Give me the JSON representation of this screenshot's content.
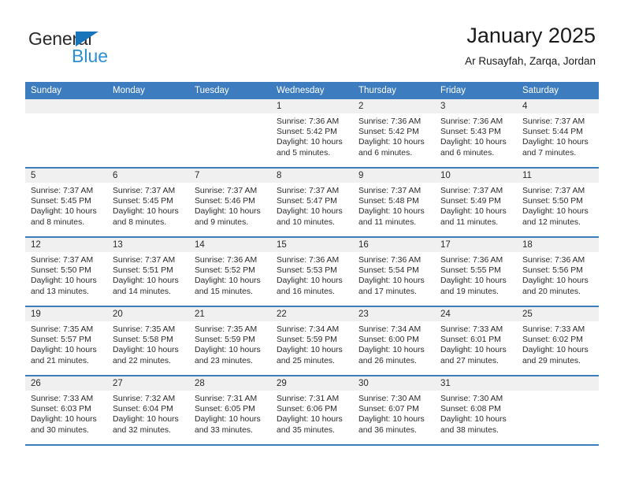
{
  "logo": {
    "primary_text": "General",
    "secondary_text": "Blue",
    "triangle_color": "#1874bb",
    "secondary_color": "#2a8fd4"
  },
  "header": {
    "title": "January 2025",
    "location": "Ar Rusayfah, Zarqa, Jordan"
  },
  "theme": {
    "header_bg": "#3d7cbf",
    "daynum_bg": "#f0f0f0",
    "divider": "#3d7cbf"
  },
  "day_headers": [
    "Sunday",
    "Monday",
    "Tuesday",
    "Wednesday",
    "Thursday",
    "Friday",
    "Saturday"
  ],
  "weeks": [
    [
      {
        "day": "",
        "sunrise": "",
        "sunset": "",
        "daylight_line1": "",
        "daylight_line2": "",
        "empty": true
      },
      {
        "day": "",
        "sunrise": "",
        "sunset": "",
        "daylight_line1": "",
        "daylight_line2": "",
        "empty": true
      },
      {
        "day": "",
        "sunrise": "",
        "sunset": "",
        "daylight_line1": "",
        "daylight_line2": "",
        "empty": true
      },
      {
        "day": "1",
        "sunrise": "Sunrise: 7:36 AM",
        "sunset": "Sunset: 5:42 PM",
        "daylight_line1": "Daylight: 10 hours",
        "daylight_line2": "and 5 minutes.",
        "empty": false
      },
      {
        "day": "2",
        "sunrise": "Sunrise: 7:36 AM",
        "sunset": "Sunset: 5:42 PM",
        "daylight_line1": "Daylight: 10 hours",
        "daylight_line2": "and 6 minutes.",
        "empty": false
      },
      {
        "day": "3",
        "sunrise": "Sunrise: 7:36 AM",
        "sunset": "Sunset: 5:43 PM",
        "daylight_line1": "Daylight: 10 hours",
        "daylight_line2": "and 6 minutes.",
        "empty": false
      },
      {
        "day": "4",
        "sunrise": "Sunrise: 7:37 AM",
        "sunset": "Sunset: 5:44 PM",
        "daylight_line1": "Daylight: 10 hours",
        "daylight_line2": "and 7 minutes.",
        "empty": false
      }
    ],
    [
      {
        "day": "5",
        "sunrise": "Sunrise: 7:37 AM",
        "sunset": "Sunset: 5:45 PM",
        "daylight_line1": "Daylight: 10 hours",
        "daylight_line2": "and 8 minutes.",
        "empty": false
      },
      {
        "day": "6",
        "sunrise": "Sunrise: 7:37 AM",
        "sunset": "Sunset: 5:45 PM",
        "daylight_line1": "Daylight: 10 hours",
        "daylight_line2": "and 8 minutes.",
        "empty": false
      },
      {
        "day": "7",
        "sunrise": "Sunrise: 7:37 AM",
        "sunset": "Sunset: 5:46 PM",
        "daylight_line1": "Daylight: 10 hours",
        "daylight_line2": "and 9 minutes.",
        "empty": false
      },
      {
        "day": "8",
        "sunrise": "Sunrise: 7:37 AM",
        "sunset": "Sunset: 5:47 PM",
        "daylight_line1": "Daylight: 10 hours",
        "daylight_line2": "and 10 minutes.",
        "empty": false
      },
      {
        "day": "9",
        "sunrise": "Sunrise: 7:37 AM",
        "sunset": "Sunset: 5:48 PM",
        "daylight_line1": "Daylight: 10 hours",
        "daylight_line2": "and 11 minutes.",
        "empty": false
      },
      {
        "day": "10",
        "sunrise": "Sunrise: 7:37 AM",
        "sunset": "Sunset: 5:49 PM",
        "daylight_line1": "Daylight: 10 hours",
        "daylight_line2": "and 11 minutes.",
        "empty": false
      },
      {
        "day": "11",
        "sunrise": "Sunrise: 7:37 AM",
        "sunset": "Sunset: 5:50 PM",
        "daylight_line1": "Daylight: 10 hours",
        "daylight_line2": "and 12 minutes.",
        "empty": false
      }
    ],
    [
      {
        "day": "12",
        "sunrise": "Sunrise: 7:37 AM",
        "sunset": "Sunset: 5:50 PM",
        "daylight_line1": "Daylight: 10 hours",
        "daylight_line2": "and 13 minutes.",
        "empty": false
      },
      {
        "day": "13",
        "sunrise": "Sunrise: 7:37 AM",
        "sunset": "Sunset: 5:51 PM",
        "daylight_line1": "Daylight: 10 hours",
        "daylight_line2": "and 14 minutes.",
        "empty": false
      },
      {
        "day": "14",
        "sunrise": "Sunrise: 7:36 AM",
        "sunset": "Sunset: 5:52 PM",
        "daylight_line1": "Daylight: 10 hours",
        "daylight_line2": "and 15 minutes.",
        "empty": false
      },
      {
        "day": "15",
        "sunrise": "Sunrise: 7:36 AM",
        "sunset": "Sunset: 5:53 PM",
        "daylight_line1": "Daylight: 10 hours",
        "daylight_line2": "and 16 minutes.",
        "empty": false
      },
      {
        "day": "16",
        "sunrise": "Sunrise: 7:36 AM",
        "sunset": "Sunset: 5:54 PM",
        "daylight_line1": "Daylight: 10 hours",
        "daylight_line2": "and 17 minutes.",
        "empty": false
      },
      {
        "day": "17",
        "sunrise": "Sunrise: 7:36 AM",
        "sunset": "Sunset: 5:55 PM",
        "daylight_line1": "Daylight: 10 hours",
        "daylight_line2": "and 19 minutes.",
        "empty": false
      },
      {
        "day": "18",
        "sunrise": "Sunrise: 7:36 AM",
        "sunset": "Sunset: 5:56 PM",
        "daylight_line1": "Daylight: 10 hours",
        "daylight_line2": "and 20 minutes.",
        "empty": false
      }
    ],
    [
      {
        "day": "19",
        "sunrise": "Sunrise: 7:35 AM",
        "sunset": "Sunset: 5:57 PM",
        "daylight_line1": "Daylight: 10 hours",
        "daylight_line2": "and 21 minutes.",
        "empty": false
      },
      {
        "day": "20",
        "sunrise": "Sunrise: 7:35 AM",
        "sunset": "Sunset: 5:58 PM",
        "daylight_line1": "Daylight: 10 hours",
        "daylight_line2": "and 22 minutes.",
        "empty": false
      },
      {
        "day": "21",
        "sunrise": "Sunrise: 7:35 AM",
        "sunset": "Sunset: 5:59 PM",
        "daylight_line1": "Daylight: 10 hours",
        "daylight_line2": "and 23 minutes.",
        "empty": false
      },
      {
        "day": "22",
        "sunrise": "Sunrise: 7:34 AM",
        "sunset": "Sunset: 5:59 PM",
        "daylight_line1": "Daylight: 10 hours",
        "daylight_line2": "and 25 minutes.",
        "empty": false
      },
      {
        "day": "23",
        "sunrise": "Sunrise: 7:34 AM",
        "sunset": "Sunset: 6:00 PM",
        "daylight_line1": "Daylight: 10 hours",
        "daylight_line2": "and 26 minutes.",
        "empty": false
      },
      {
        "day": "24",
        "sunrise": "Sunrise: 7:33 AM",
        "sunset": "Sunset: 6:01 PM",
        "daylight_line1": "Daylight: 10 hours",
        "daylight_line2": "and 27 minutes.",
        "empty": false
      },
      {
        "day": "25",
        "sunrise": "Sunrise: 7:33 AM",
        "sunset": "Sunset: 6:02 PM",
        "daylight_line1": "Daylight: 10 hours",
        "daylight_line2": "and 29 minutes.",
        "empty": false
      }
    ],
    [
      {
        "day": "26",
        "sunrise": "Sunrise: 7:33 AM",
        "sunset": "Sunset: 6:03 PM",
        "daylight_line1": "Daylight: 10 hours",
        "daylight_line2": "and 30 minutes.",
        "empty": false
      },
      {
        "day": "27",
        "sunrise": "Sunrise: 7:32 AM",
        "sunset": "Sunset: 6:04 PM",
        "daylight_line1": "Daylight: 10 hours",
        "daylight_line2": "and 32 minutes.",
        "empty": false
      },
      {
        "day": "28",
        "sunrise": "Sunrise: 7:31 AM",
        "sunset": "Sunset: 6:05 PM",
        "daylight_line1": "Daylight: 10 hours",
        "daylight_line2": "and 33 minutes.",
        "empty": false
      },
      {
        "day": "29",
        "sunrise": "Sunrise: 7:31 AM",
        "sunset": "Sunset: 6:06 PM",
        "daylight_line1": "Daylight: 10 hours",
        "daylight_line2": "and 35 minutes.",
        "empty": false
      },
      {
        "day": "30",
        "sunrise": "Sunrise: 7:30 AM",
        "sunset": "Sunset: 6:07 PM",
        "daylight_line1": "Daylight: 10 hours",
        "daylight_line2": "and 36 minutes.",
        "empty": false
      },
      {
        "day": "31",
        "sunrise": "Sunrise: 7:30 AM",
        "sunset": "Sunset: 6:08 PM",
        "daylight_line1": "Daylight: 10 hours",
        "daylight_line2": "and 38 minutes.",
        "empty": false
      },
      {
        "day": "",
        "sunrise": "",
        "sunset": "",
        "daylight_line1": "",
        "daylight_line2": "",
        "empty": true
      }
    ]
  ]
}
